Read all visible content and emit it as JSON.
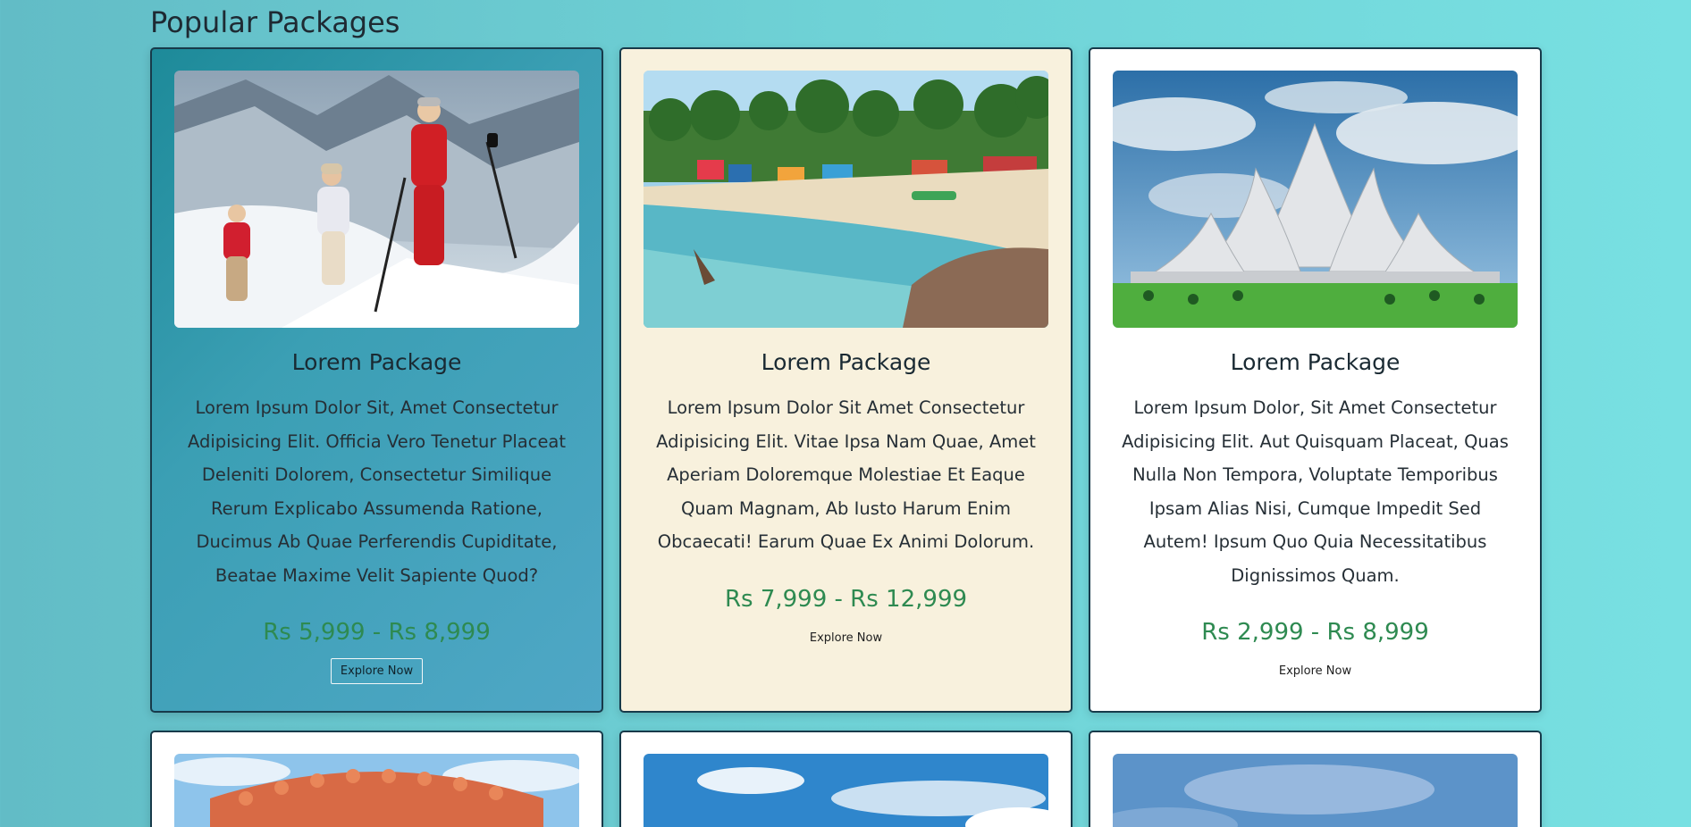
{
  "page": {
    "title": "Popular Packages"
  },
  "packages": [
    {
      "title": "Lorem Package",
      "description": "Lorem Ipsum Dolor Sit, Amet Consectetur Adipisicing Elit. Officia Vero Tenetur Placeat Deleniti Dolorem, Consectetur Similique Rerum Explicabo Assumenda Ratione, Ducimus Ab Quae Perferendis Cupiditate, Beatae Maxime Velit Sapiente Quod?",
      "price": "Rs 5,999 - Rs 8,999",
      "button": "Explore Now",
      "image": "snow-trekking-photo"
    },
    {
      "title": "Lorem Package",
      "description": "Lorem Ipsum Dolor Sit Amet Consectetur Adipisicing Elit. Vitae Ipsa Nam Quae, Amet Aperiam Doloremque Molestiae Et Eaque Quam Magnam, Ab Iusto Harum Enim Obcaecati! Earum Quae Ex Animi Dolorum.",
      "price": "Rs 7,999 - Rs 12,999",
      "button": "Explore Now",
      "image": "beach-photo"
    },
    {
      "title": "Lorem Package",
      "description": "Lorem Ipsum Dolor, Sit Amet Consectetur Adipisicing Elit. Aut Quisquam Placeat, Quas Nulla Non Tempora, Voluptate Temporibus Ipsam Alias Nisi, Cumque Impedit Sed Autem! Ipsum Quo Quia Necessitatibus Dignissimos Quam.",
      "price": "Rs 2,999 - Rs 8,999",
      "button": "Explore Now",
      "image": "lotus-temple-photo"
    }
  ],
  "packages_row2": [
    {
      "image": "palace-photo"
    },
    {
      "image": "sky-clouds-photo"
    },
    {
      "image": "cloudy-sky-photo"
    }
  ],
  "colors": {
    "background": "#6fd2d6",
    "price": "#2e8a51",
    "card_teal": "#3b9fb4",
    "card_cream": "#f8f1dd",
    "card_white": "#ffffff",
    "border": "#173a4a"
  }
}
